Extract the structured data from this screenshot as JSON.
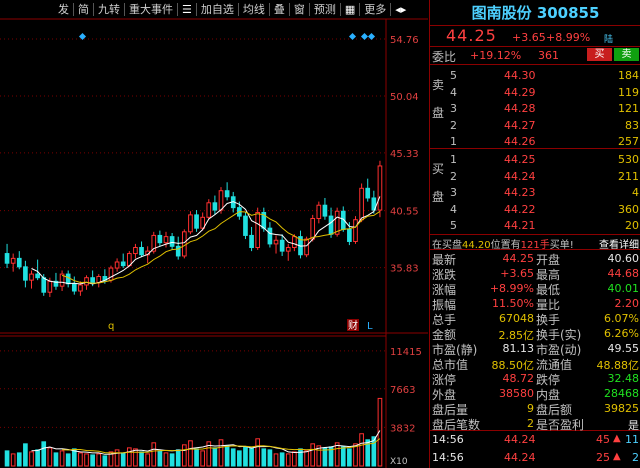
{
  "toolbar": {
    "items": [
      "发",
      "简",
      "九转",
      "重大事件",
      "加自选",
      "均线",
      "叠",
      "窗",
      "预测",
      "更多"
    ],
    "icons": [
      "list-icon",
      "grid-icon",
      "pin-icon"
    ]
  },
  "stock": {
    "name": "图南股份",
    "code": "300855",
    "market_tag": "陆"
  },
  "quote": {
    "price": "44.25",
    "change": "+3.65",
    "change_pct": "+8.99%"
  },
  "weibi": {
    "label": "委比",
    "ratio": "+19.12%",
    "diff": "361",
    "buy_btn": "买",
    "sell_btn": "卖"
  },
  "order_book": {
    "sell_label": "卖盘",
    "buy_label": "买盘",
    "sell": [
      {
        "level": "5",
        "price": "44.30",
        "vol": "184"
      },
      {
        "level": "4",
        "price": "44.29",
        "vol": "119"
      },
      {
        "level": "3",
        "price": "44.28",
        "vol": "121"
      },
      {
        "level": "2",
        "price": "44.27",
        "vol": "83"
      },
      {
        "level": "1",
        "price": "44.26",
        "vol": "257"
      }
    ],
    "buy": [
      {
        "level": "1",
        "price": "44.25",
        "vol": "530"
      },
      {
        "level": "2",
        "price": "44.24",
        "vol": "211"
      },
      {
        "level": "3",
        "price": "44.23",
        "vol": "4"
      },
      {
        "level": "4",
        "price": "44.22",
        "vol": "360"
      },
      {
        "level": "5",
        "price": "44.21",
        "vol": "20"
      }
    ]
  },
  "notice": {
    "prefix": "在买盘",
    "price": "44.20",
    "mid": "位置有",
    "qty": "121手",
    "suffix": "买单!",
    "link": "查看详细"
  },
  "stats": [
    {
      "l1": "最新",
      "v1": "44.25",
      "c1": "red",
      "l2": "开盘",
      "v2": "40.60",
      "c2": "wht"
    },
    {
      "l1": "涨跌",
      "v1": "+3.65",
      "c1": "red",
      "l2": "最高",
      "v2": "44.68",
      "c2": "red"
    },
    {
      "l1": "涨幅",
      "v1": "+8.99%",
      "c1": "red",
      "l2": "最低",
      "v2": "40.01",
      "c2": "green"
    },
    {
      "l1": "振幅",
      "v1": "11.50%",
      "c1": "red",
      "l2": "量比",
      "v2": "2.20",
      "c2": "red"
    },
    {
      "l1": "总手",
      "v1": "67048",
      "c1": "yel",
      "l2": "换手",
      "v2": "6.07%",
      "c2": "yel"
    },
    {
      "l1": "金额",
      "v1": "2.85亿",
      "c1": "yel",
      "l2": "换手(实)",
      "v2": "6.26%",
      "c2": "yel"
    },
    {
      "l1": "市盈(静)",
      "v1": "81.13",
      "c1": "wht",
      "l2": "市盈(动)",
      "v2": "49.55",
      "c2": "wht"
    },
    {
      "l1": "总市值",
      "v1": "88.50亿",
      "c1": "yel",
      "l2": "流通值",
      "v2": "48.88亿",
      "c2": "yel"
    },
    {
      "l1": "涨停",
      "v1": "48.72",
      "c1": "red",
      "l2": "跌停",
      "v2": "32.48",
      "c2": "green"
    },
    {
      "l1": "外盘",
      "v1": "38580",
      "c1": "red",
      "l2": "内盘",
      "v2": "28468",
      "c2": "green"
    },
    {
      "l1": "盘后量",
      "v1": "9",
      "c1": "yel",
      "l2": "盘后额",
      "v2": "39825",
      "c2": "yel"
    },
    {
      "l1": "盘后笔数",
      "v1": "2",
      "c1": "yel",
      "l2": "是否盈利",
      "v2": "是",
      "c2": "wht"
    }
  ],
  "ticks": [
    {
      "time": "14:56",
      "price": "44.24",
      "vol": "45",
      "num": "11"
    },
    {
      "time": "14:56",
      "price": "44.24",
      "vol": "25",
      "num": "2"
    }
  ],
  "chart_data": {
    "type": "candlestick",
    "price_axis": {
      "ticks": [
        "54.76",
        "50.04",
        "45.33",
        "40.55",
        "35.83"
      ],
      "ylim": [
        31.5,
        56.0
      ]
    },
    "volume_axis": {
      "ticks": [
        "11415",
        "7663",
        "3832"
      ],
      "unit": "X10"
    },
    "markers": [
      "q",
      "财",
      "L"
    ],
    "candles": [
      {
        "o": 37.0,
        "h": 37.8,
        "l": 35.8,
        "c": 36.2,
        "v": 1500
      },
      {
        "o": 36.2,
        "h": 37.0,
        "l": 35.5,
        "c": 36.6,
        "v": 1200
      },
      {
        "o": 36.6,
        "h": 37.2,
        "l": 35.7,
        "c": 35.9,
        "v": 1300
      },
      {
        "o": 35.9,
        "h": 36.4,
        "l": 34.2,
        "c": 34.8,
        "v": 2200
      },
      {
        "o": 34.8,
        "h": 35.6,
        "l": 34.1,
        "c": 35.3,
        "v": 1400
      },
      {
        "o": 35.3,
        "h": 36.5,
        "l": 34.8,
        "c": 35.0,
        "v": 1600
      },
      {
        "o": 35.0,
        "h": 35.3,
        "l": 33.5,
        "c": 33.8,
        "v": 2400
      },
      {
        "o": 33.8,
        "h": 35.0,
        "l": 33.4,
        "c": 34.7,
        "v": 1800
      },
      {
        "o": 34.7,
        "h": 35.4,
        "l": 34.0,
        "c": 34.3,
        "v": 1300
      },
      {
        "o": 34.3,
        "h": 35.6,
        "l": 33.9,
        "c": 35.3,
        "v": 1500
      },
      {
        "o": 35.3,
        "h": 35.6,
        "l": 34.2,
        "c": 34.5,
        "v": 1200
      },
      {
        "o": 34.5,
        "h": 35.1,
        "l": 33.6,
        "c": 33.9,
        "v": 1700
      },
      {
        "o": 33.9,
        "h": 34.7,
        "l": 33.5,
        "c": 34.4,
        "v": 1300
      },
      {
        "o": 34.4,
        "h": 35.2,
        "l": 34.0,
        "c": 35.0,
        "v": 1200
      },
      {
        "o": 35.0,
        "h": 35.6,
        "l": 34.3,
        "c": 34.6,
        "v": 1100
      },
      {
        "o": 34.6,
        "h": 35.3,
        "l": 34.2,
        "c": 35.1,
        "v": 1200
      },
      {
        "o": 35.1,
        "h": 35.7,
        "l": 34.5,
        "c": 34.8,
        "v": 1000
      },
      {
        "o": 34.8,
        "h": 36.0,
        "l": 34.6,
        "c": 35.8,
        "v": 1400
      },
      {
        "o": 35.8,
        "h": 36.6,
        "l": 35.5,
        "c": 36.3,
        "v": 1600
      },
      {
        "o": 36.3,
        "h": 37.0,
        "l": 35.8,
        "c": 36.0,
        "v": 1300
      },
      {
        "o": 36.0,
        "h": 37.2,
        "l": 35.9,
        "c": 37.0,
        "v": 1800
      },
      {
        "o": 37.0,
        "h": 37.8,
        "l": 36.6,
        "c": 37.5,
        "v": 1700
      },
      {
        "o": 37.5,
        "h": 38.0,
        "l": 36.7,
        "c": 36.9,
        "v": 1400
      },
      {
        "o": 36.9,
        "h": 37.6,
        "l": 36.2,
        "c": 37.2,
        "v": 1200
      },
      {
        "o": 37.2,
        "h": 38.8,
        "l": 37.0,
        "c": 38.5,
        "v": 2300
      },
      {
        "o": 38.5,
        "h": 38.9,
        "l": 37.6,
        "c": 37.9,
        "v": 1500
      },
      {
        "o": 37.9,
        "h": 38.8,
        "l": 37.5,
        "c": 38.4,
        "v": 1300
      },
      {
        "o": 38.4,
        "h": 38.7,
        "l": 37.3,
        "c": 37.6,
        "v": 1200
      },
      {
        "o": 37.6,
        "h": 38.4,
        "l": 36.5,
        "c": 36.8,
        "v": 1600
      },
      {
        "o": 36.8,
        "h": 39.0,
        "l": 36.6,
        "c": 38.8,
        "v": 2100
      },
      {
        "o": 38.8,
        "h": 40.5,
        "l": 38.6,
        "c": 40.2,
        "v": 2500
      },
      {
        "o": 40.2,
        "h": 40.6,
        "l": 38.8,
        "c": 39.1,
        "v": 1700
      },
      {
        "o": 39.1,
        "h": 40.4,
        "l": 38.9,
        "c": 40.0,
        "v": 1500
      },
      {
        "o": 40.0,
        "h": 41.5,
        "l": 39.8,
        "c": 41.2,
        "v": 2400
      },
      {
        "o": 41.2,
        "h": 41.8,
        "l": 40.2,
        "c": 40.6,
        "v": 1800
      },
      {
        "o": 40.6,
        "h": 42.5,
        "l": 40.3,
        "c": 42.2,
        "v": 2600
      },
      {
        "o": 42.2,
        "h": 42.9,
        "l": 41.4,
        "c": 41.7,
        "v": 2000
      },
      {
        "o": 41.7,
        "h": 42.1,
        "l": 40.4,
        "c": 40.8,
        "v": 1700
      },
      {
        "o": 40.8,
        "h": 41.3,
        "l": 39.8,
        "c": 40.1,
        "v": 1500
      },
      {
        "o": 40.1,
        "h": 40.4,
        "l": 38.2,
        "c": 38.5,
        "v": 1900
      },
      {
        "o": 38.5,
        "h": 39.2,
        "l": 37.2,
        "c": 37.5,
        "v": 1800
      },
      {
        "o": 37.5,
        "h": 40.8,
        "l": 37.3,
        "c": 40.4,
        "v": 2700
      },
      {
        "o": 40.4,
        "h": 40.8,
        "l": 38.8,
        "c": 39.1,
        "v": 1700
      },
      {
        "o": 39.1,
        "h": 39.6,
        "l": 37.5,
        "c": 37.8,
        "v": 1600
      },
      {
        "o": 37.8,
        "h": 38.5,
        "l": 37.0,
        "c": 38.1,
        "v": 1200
      },
      {
        "o": 38.1,
        "h": 38.6,
        "l": 36.8,
        "c": 37.2,
        "v": 1300
      },
      {
        "o": 37.2,
        "h": 37.8,
        "l": 36.4,
        "c": 37.5,
        "v": 1200
      },
      {
        "o": 37.5,
        "h": 38.6,
        "l": 37.2,
        "c": 38.4,
        "v": 1400
      },
      {
        "o": 38.4,
        "h": 38.9,
        "l": 36.6,
        "c": 36.9,
        "v": 1700
      },
      {
        "o": 36.9,
        "h": 38.4,
        "l": 36.7,
        "c": 38.2,
        "v": 1500
      },
      {
        "o": 38.2,
        "h": 40.2,
        "l": 38.0,
        "c": 39.9,
        "v": 2200
      },
      {
        "o": 39.9,
        "h": 41.3,
        "l": 39.5,
        "c": 41.0,
        "v": 2000
      },
      {
        "o": 41.0,
        "h": 41.6,
        "l": 39.8,
        "c": 40.1,
        "v": 1800
      },
      {
        "o": 40.1,
        "h": 40.8,
        "l": 38.3,
        "c": 38.6,
        "v": 1900
      },
      {
        "o": 38.6,
        "h": 40.8,
        "l": 38.4,
        "c": 40.5,
        "v": 2300
      },
      {
        "o": 40.5,
        "h": 40.9,
        "l": 38.8,
        "c": 39.0,
        "v": 1900
      },
      {
        "o": 39.0,
        "h": 39.6,
        "l": 37.7,
        "c": 38.0,
        "v": 1700
      },
      {
        "o": 38.0,
        "h": 40.1,
        "l": 37.8,
        "c": 39.8,
        "v": 2200
      },
      {
        "o": 39.8,
        "h": 42.8,
        "l": 39.6,
        "c": 42.4,
        "v": 3200
      },
      {
        "o": 42.4,
        "h": 43.2,
        "l": 41.3,
        "c": 41.6,
        "v": 2600
      },
      {
        "o": 41.6,
        "h": 42.2,
        "l": 40.3,
        "c": 40.6,
        "v": 2900
      },
      {
        "o": 40.6,
        "h": 44.68,
        "l": 40.01,
        "c": 44.25,
        "v": 6705
      }
    ]
  }
}
